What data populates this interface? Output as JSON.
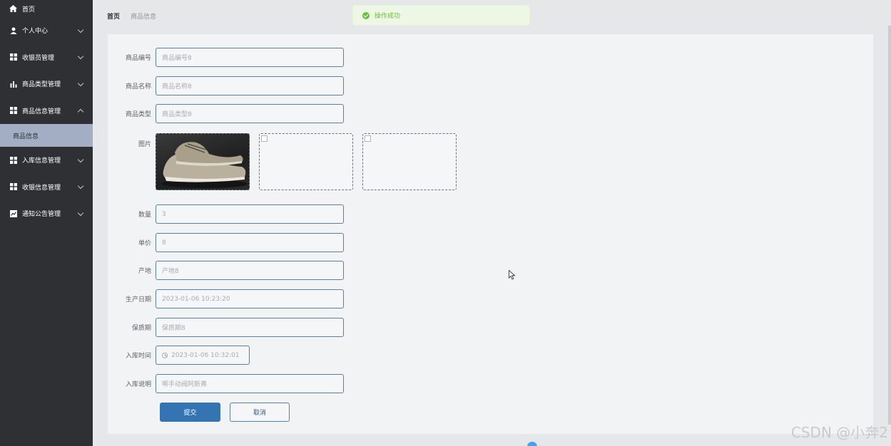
{
  "sidebar": {
    "items": [
      {
        "label": "首页",
        "icon": "home-icon"
      },
      {
        "label": "个人中心",
        "icon": "user-icon"
      },
      {
        "label": "收银员管理",
        "icon": "grid-icon"
      },
      {
        "label": "商品类型管理",
        "icon": "bar-chart-icon"
      },
      {
        "label": "商品信息管理",
        "icon": "grid-icon"
      },
      {
        "label": "入库信息管理",
        "icon": "grid-icon"
      },
      {
        "label": "收银信息管理",
        "icon": "grid-icon"
      },
      {
        "label": "通知公告管理",
        "icon": "line-chart-icon"
      }
    ],
    "active_sub": "商品信息"
  },
  "breadcrumb": {
    "home": "首页",
    "current": "商品信息"
  },
  "toast": {
    "message": "操作成功",
    "color": "#67c23a"
  },
  "form": {
    "fields": {
      "code": {
        "label": "商品编号",
        "value": "商品编号8"
      },
      "name": {
        "label": "商品名称",
        "value": "商品名称8"
      },
      "type": {
        "label": "商品类型",
        "value": "商品类型8"
      },
      "images": {
        "label": "图片"
      },
      "quantity": {
        "label": "数量",
        "value": "3"
      },
      "price": {
        "label": "单价",
        "value": "8"
      },
      "origin": {
        "label": "产地",
        "value": "产地8"
      },
      "prod_date": {
        "label": "生产日期",
        "value": "2023-01-06 10:23:20"
      },
      "shelf_life": {
        "label": "保质期",
        "value": "保质期8"
      },
      "in_time": {
        "label": "入库时间",
        "value": "2023-01-06 10:32:01"
      },
      "in_note": {
        "label": "入库说明",
        "value": "啊手动阀阿斯弗"
      }
    },
    "submit": "提交",
    "cancel": "取消"
  },
  "watermark": "CSDN @小奔2",
  "colors": {
    "sidebar_bg": "#2f3033",
    "active_sub_bg": "#a3aec5",
    "primary": "#3574b3"
  }
}
